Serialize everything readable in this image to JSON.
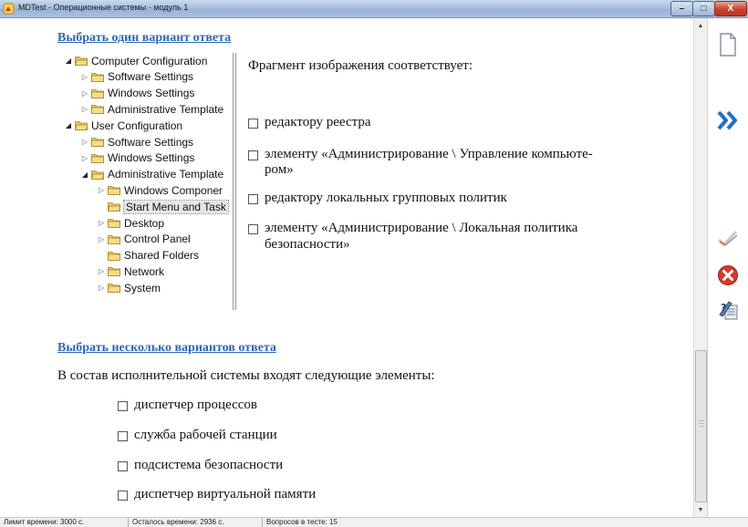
{
  "window": {
    "title": "MDTest - Операционные системы - модуль 1",
    "minimize_glyph": "–",
    "maximize_glyph": "□",
    "close_glyph": "X"
  },
  "q1": {
    "heading": "Выбрать один вариант ответа",
    "prompt": "Фрагмент изображения соответствует:",
    "options": [
      {
        "line1": "редактору реестра",
        "line2": ""
      },
      {
        "line1": "элементу «Администрирование \\ Управление компьюте-",
        "line2": "ром»"
      },
      {
        "line1": "редактору локальных групповых политик",
        "line2": ""
      },
      {
        "line1": "элементу «Администрирование \\ Локальная политика",
        "line2": "безопасности»"
      }
    ],
    "tree": [
      {
        "label": "Computer Configuration",
        "level": 0,
        "arrow": "open",
        "folder": "open"
      },
      {
        "label": "Software Settings",
        "level": 1,
        "arrow": "closed",
        "folder": "closed"
      },
      {
        "label": "Windows Settings",
        "level": 1,
        "arrow": "closed",
        "folder": "closed"
      },
      {
        "label": "Administrative Template",
        "level": 1,
        "arrow": "closed",
        "folder": "closed"
      },
      {
        "label": "User Configuration",
        "level": 0,
        "arrow": "open",
        "folder": "open"
      },
      {
        "label": "Software Settings",
        "level": 1,
        "arrow": "closed",
        "folder": "closed"
      },
      {
        "label": "Windows Settings",
        "level": 1,
        "arrow": "closed",
        "folder": "closed"
      },
      {
        "label": "Administrative Template",
        "level": 1,
        "arrow": "open",
        "folder": "open"
      },
      {
        "label": "Windows Componer",
        "level": 2,
        "arrow": "closed",
        "folder": "closed"
      },
      {
        "label": "Start Menu and Task",
        "level": 2,
        "arrow": "none",
        "folder": "open",
        "selected": true
      },
      {
        "label": "Desktop",
        "level": 2,
        "arrow": "closed",
        "folder": "closed"
      },
      {
        "label": "Control Panel",
        "level": 2,
        "arrow": "closed",
        "folder": "closed"
      },
      {
        "label": "Shared Folders",
        "level": 2,
        "arrow": "none",
        "folder": "closed"
      },
      {
        "label": "Network",
        "level": 2,
        "arrow": "closed",
        "folder": "closed"
      },
      {
        "label": "System",
        "level": 2,
        "arrow": "closed",
        "folder": "closed"
      }
    ]
  },
  "q2": {
    "heading": "Выбрать несколько вариантов ответа",
    "prompt": "В состав исполнительной системы входят следующие элементы:",
    "options": [
      "диспетчер процессов",
      "служба рабочей станции",
      "подсистема безопасности",
      "диспетчер виртуальной памяти"
    ]
  },
  "sidebar": {
    "icons": [
      "new-page-icon",
      "next-icon",
      "check-answer-icon",
      "cancel-icon",
      "help-icon"
    ]
  },
  "status": {
    "time_limit": "Лимит времени: 3000 с.",
    "time_left": "Осталось времени: 2936 с.",
    "questions": "Вопросов в тесте: 15"
  },
  "colors": {
    "link": "#2e66b3",
    "accent_blue": "#1f6fc5",
    "close_red": "#d13b2a"
  }
}
